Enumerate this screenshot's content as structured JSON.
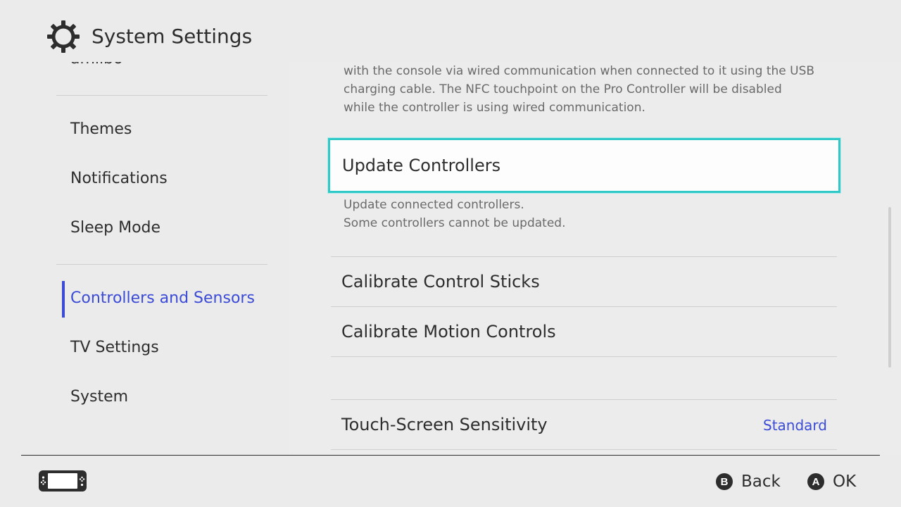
{
  "header": {
    "title": "System Settings",
    "icon": "gear-icon"
  },
  "sidebar": {
    "cut_item": "amiibo",
    "items": [
      {
        "label": "Themes"
      },
      {
        "label": "Notifications"
      },
      {
        "label": "Sleep Mode"
      },
      {
        "label": "Controllers and Sensors",
        "active": true
      },
      {
        "label": "TV Settings"
      },
      {
        "label": "System"
      }
    ],
    "accent_color": "#3b4bd6"
  },
  "main": {
    "top_description": [
      "with the console via wired communication when connected to it using the USB",
      "charging cable. The NFC touchpoint on the Pro Controller will be disabled",
      "while the controller is using wired communication."
    ],
    "selected_item": {
      "label": "Update Controllers",
      "description": [
        "Update connected controllers.",
        "Some controllers cannot be updated."
      ],
      "highlight_color": "#2fc9c8"
    },
    "items": [
      {
        "label": "Calibrate Control Sticks"
      },
      {
        "label": "Calibrate Motion Controls"
      },
      {
        "label": "Touch-Screen Sensitivity",
        "value": "Standard"
      }
    ]
  },
  "footer": {
    "console_icon": "handheld-console-icon",
    "back": {
      "button": "B",
      "label": "Back"
    },
    "ok": {
      "button": "A",
      "label": "OK"
    }
  }
}
